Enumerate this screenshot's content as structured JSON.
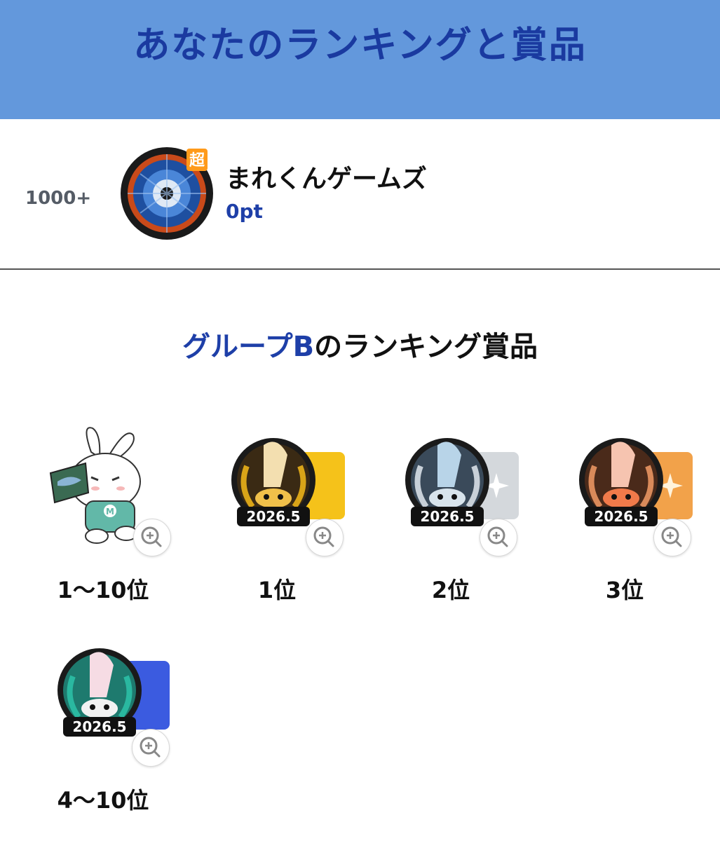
{
  "header": {
    "title": "あなたのランキングと賞品"
  },
  "me": {
    "rank": "1000+",
    "name": "まれくんゲームズ",
    "points": "0pt",
    "badge": "超"
  },
  "section": {
    "accent": "グループB",
    "rest": "のランキング賞品"
  },
  "prizes": [
    {
      "label": "1〜10位",
      "kind": "rabbit-sticker"
    },
    {
      "label": "1位",
      "kind": "gold-badge",
      "year": "2026.5"
    },
    {
      "label": "2位",
      "kind": "silver-badge",
      "year": "2026.5"
    },
    {
      "label": "3位",
      "kind": "bronze-badge",
      "year": "2026.5"
    },
    {
      "label": "4〜10位",
      "kind": "teal-badge",
      "year": "2026.5"
    }
  ],
  "colors": {
    "header_bg": "#6398dc",
    "header_text": "#1a3aa0",
    "accent": "#1e3fa8"
  }
}
